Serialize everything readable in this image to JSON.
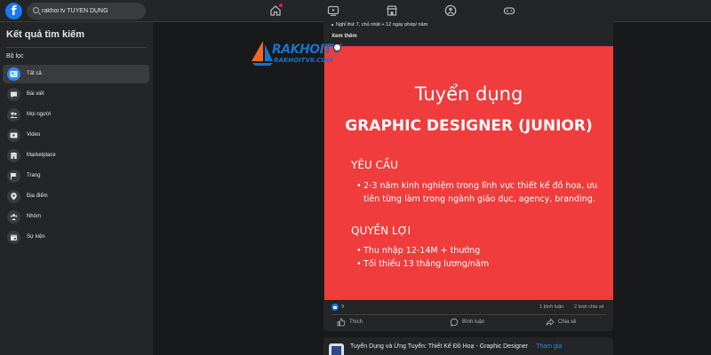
{
  "topbar": {
    "logo": "f",
    "search_value": "rakhoi tv TUYỂN DỤNG",
    "icons": [
      "home-icon",
      "watch-icon",
      "marketplace-icon",
      "groups-icon",
      "gaming-icon"
    ]
  },
  "sidebar": {
    "title": "Kết quả tìm kiếm",
    "filter_label": "Bộ lọc",
    "items": [
      {
        "label": "Tất cả",
        "icon": "all-results-icon",
        "active": true
      },
      {
        "label": "Bài viết",
        "icon": "posts-icon"
      },
      {
        "label": "Mọi người",
        "icon": "people-icon"
      },
      {
        "label": "Video",
        "icon": "video-icon"
      },
      {
        "label": "Marketplace",
        "icon": "marketplace-icon"
      },
      {
        "label": "Trang",
        "icon": "flag-icon"
      },
      {
        "label": "Địa điểm",
        "icon": "location-icon"
      },
      {
        "label": "Nhóm",
        "icon": "groups-icon"
      },
      {
        "label": "Sự kiện",
        "icon": "calendar-icon"
      }
    ]
  },
  "post": {
    "prev_text": "Nghỉ thứ 7, chủ nhật + 12 ngày phép/ năm",
    "see_more": "Xem thêm",
    "watermark_main": "RAKHOITV",
    "watermark_sub": "RAKHOITV8.COM",
    "banner": {
      "heading": "Tuyển dụng",
      "subheading": "GRAPHIC DESIGNER (JUNIOR)",
      "req_title": "YÊU CẦU",
      "req_line1": "2-3 năm kinh nghiệm trong lĩnh vực thiết kế đồ họa, ưu",
      "req_line2": "tiên từng làm trong ngành giáo dục, agency, branding.",
      "ben_title": "QUYỀN LỢI",
      "ben_line1": "Thu nhập 12-14M + thưởng",
      "ben_line2": "Tối thiểu 13 tháng lương/năm"
    },
    "reactions_count": "9",
    "comments": "1 bình luận",
    "shares": "2 lượt chia sẻ",
    "actions": {
      "like": "Thích",
      "comment": "Bình luận",
      "share": "Chia sẻ"
    }
  },
  "post2": {
    "title": "Tuyển Dụng và Ứng Tuyển: Thiết Kế Đồ Hoạ - Graphic Designer",
    "join": "· Tham gia"
  },
  "colors": {
    "accent": "#2d88ff",
    "banner": "#f03c3c",
    "bg": "#18191a",
    "card": "#242526"
  }
}
